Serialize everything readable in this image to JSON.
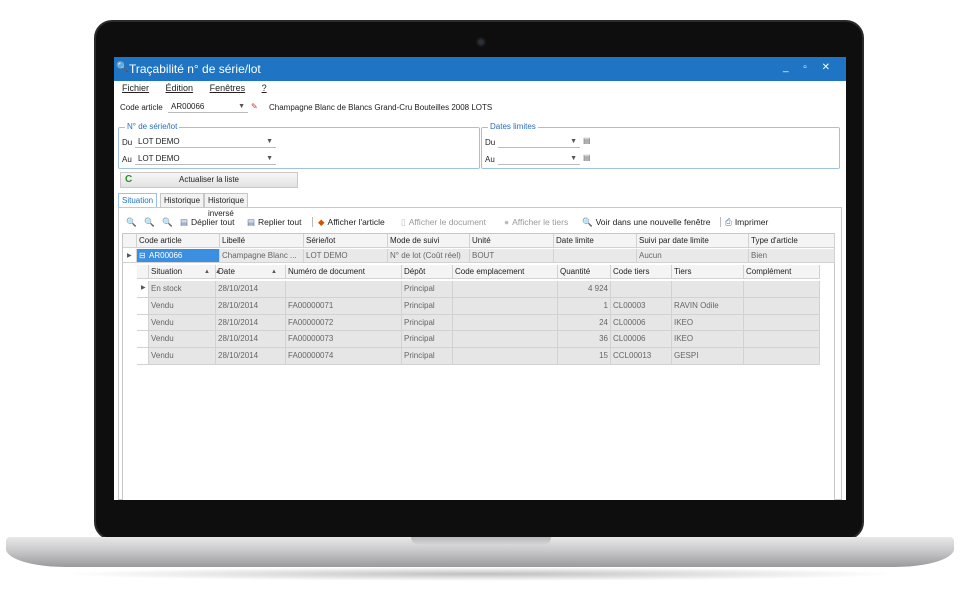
{
  "window": {
    "title": "Traçabilité n° de série/lot",
    "controls": "_ ▫ ✕"
  },
  "menu": [
    "Fichier",
    "Édition",
    "Fenêtres",
    "?"
  ],
  "article": {
    "label": "Code article",
    "value": "AR00066",
    "description": "Champagne Blanc de Blancs Grand-Cru Bouteilles 2008 LOTS"
  },
  "serial_group": {
    "title": "N° de série/lot",
    "from_label": "Du",
    "from_value": "LOT DEMO",
    "to_label": "Au",
    "to_value": "LOT DEMO"
  },
  "dates_group": {
    "title": "Dates limites",
    "from_label": "Du",
    "to_label": "Au"
  },
  "refresh_button": "Actualiser la liste",
  "tabs": [
    "Situation",
    "Historique",
    "Historique inversé"
  ],
  "toolbar": {
    "expand_all": "Déplier tout",
    "collapse_all": "Replier tout",
    "show_article": "Afficher l'article",
    "show_document": "Afficher le document",
    "show_third_party": "Afficher le tiers",
    "new_window": "Voir dans une nouvelle fenêtre",
    "print": "Imprimer"
  },
  "master_grid": {
    "columns": [
      "Code article",
      "Libellé",
      "Série/lot",
      "Mode de suivi",
      "Unité",
      "Date limite",
      "Suivi par date limite",
      "Type d'article"
    ],
    "row": [
      "AR00066",
      "Champagne Blanc ...",
      "LOT DEMO",
      "N° de lot (Coût réel)",
      "BOUT",
      "",
      "Aucun",
      "Bien"
    ]
  },
  "detail_grid": {
    "columns": [
      "Situation",
      "Date",
      "Numéro de document",
      "Dépôt",
      "Code emplacement",
      "Quantité",
      "Code tiers",
      "Tiers",
      "Complément"
    ],
    "rows": [
      [
        "En stock",
        "28/10/2014",
        "",
        "Principal",
        "",
        "4 924",
        "",
        "",
        ""
      ],
      [
        "Vendu",
        "28/10/2014",
        "FA00000071",
        "Principal",
        "",
        "1",
        "CL00003",
        "RAVIN Odile",
        ""
      ],
      [
        "Vendu",
        "28/10/2014",
        "FA00000072",
        "Principal",
        "",
        "24",
        "CL00006",
        "IKEO",
        ""
      ],
      [
        "Vendu",
        "28/10/2014",
        "FA00000073",
        "Principal",
        "",
        "36",
        "CL00006",
        "IKEO",
        ""
      ],
      [
        "Vendu",
        "28/10/2014",
        "FA00000074",
        "Principal",
        "",
        "15",
        "CCL00013",
        "GESPI",
        ""
      ]
    ]
  },
  "colors": {
    "titlebar": "#1f74c4",
    "selection": "#3b8fe0",
    "group_border": "#9cc3e6"
  }
}
